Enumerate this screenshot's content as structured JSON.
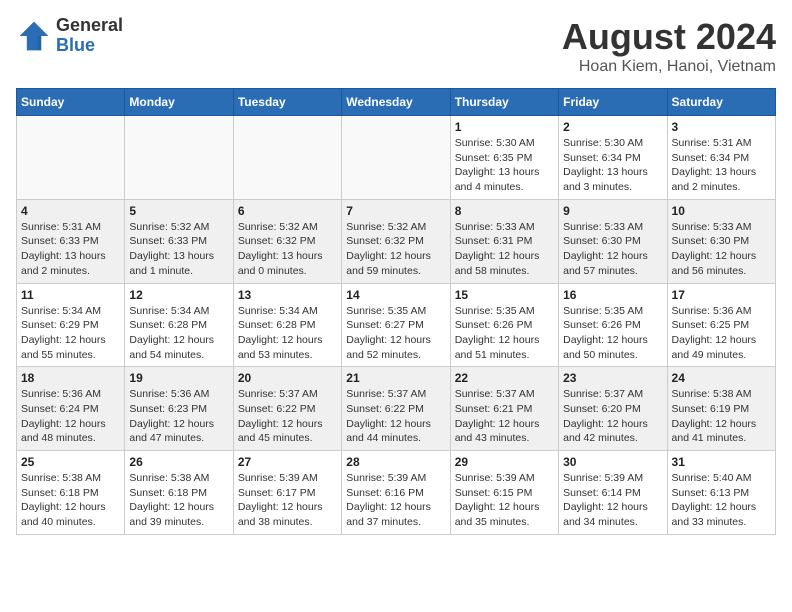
{
  "header": {
    "logo": {
      "general": "General",
      "blue": "Blue"
    },
    "title": "August 2024",
    "location": "Hoan Kiem, Hanoi, Vietnam"
  },
  "weekdays": [
    "Sunday",
    "Monday",
    "Tuesday",
    "Wednesday",
    "Thursday",
    "Friday",
    "Saturday"
  ],
  "weeks": [
    [
      {
        "day": "",
        "info": ""
      },
      {
        "day": "",
        "info": ""
      },
      {
        "day": "",
        "info": ""
      },
      {
        "day": "",
        "info": ""
      },
      {
        "day": "1",
        "info": "Sunrise: 5:30 AM\nSunset: 6:35 PM\nDaylight: 13 hours\nand 4 minutes."
      },
      {
        "day": "2",
        "info": "Sunrise: 5:30 AM\nSunset: 6:34 PM\nDaylight: 13 hours\nand 3 minutes."
      },
      {
        "day": "3",
        "info": "Sunrise: 5:31 AM\nSunset: 6:34 PM\nDaylight: 13 hours\nand 2 minutes."
      }
    ],
    [
      {
        "day": "4",
        "info": "Sunrise: 5:31 AM\nSunset: 6:33 PM\nDaylight: 13 hours\nand 2 minutes."
      },
      {
        "day": "5",
        "info": "Sunrise: 5:32 AM\nSunset: 6:33 PM\nDaylight: 13 hours\nand 1 minute."
      },
      {
        "day": "6",
        "info": "Sunrise: 5:32 AM\nSunset: 6:32 PM\nDaylight: 13 hours\nand 0 minutes."
      },
      {
        "day": "7",
        "info": "Sunrise: 5:32 AM\nSunset: 6:32 PM\nDaylight: 12 hours\nand 59 minutes."
      },
      {
        "day": "8",
        "info": "Sunrise: 5:33 AM\nSunset: 6:31 PM\nDaylight: 12 hours\nand 58 minutes."
      },
      {
        "day": "9",
        "info": "Sunrise: 5:33 AM\nSunset: 6:30 PM\nDaylight: 12 hours\nand 57 minutes."
      },
      {
        "day": "10",
        "info": "Sunrise: 5:33 AM\nSunset: 6:30 PM\nDaylight: 12 hours\nand 56 minutes."
      }
    ],
    [
      {
        "day": "11",
        "info": "Sunrise: 5:34 AM\nSunset: 6:29 PM\nDaylight: 12 hours\nand 55 minutes."
      },
      {
        "day": "12",
        "info": "Sunrise: 5:34 AM\nSunset: 6:28 PM\nDaylight: 12 hours\nand 54 minutes."
      },
      {
        "day": "13",
        "info": "Sunrise: 5:34 AM\nSunset: 6:28 PM\nDaylight: 12 hours\nand 53 minutes."
      },
      {
        "day": "14",
        "info": "Sunrise: 5:35 AM\nSunset: 6:27 PM\nDaylight: 12 hours\nand 52 minutes."
      },
      {
        "day": "15",
        "info": "Sunrise: 5:35 AM\nSunset: 6:26 PM\nDaylight: 12 hours\nand 51 minutes."
      },
      {
        "day": "16",
        "info": "Sunrise: 5:35 AM\nSunset: 6:26 PM\nDaylight: 12 hours\nand 50 minutes."
      },
      {
        "day": "17",
        "info": "Sunrise: 5:36 AM\nSunset: 6:25 PM\nDaylight: 12 hours\nand 49 minutes."
      }
    ],
    [
      {
        "day": "18",
        "info": "Sunrise: 5:36 AM\nSunset: 6:24 PM\nDaylight: 12 hours\nand 48 minutes."
      },
      {
        "day": "19",
        "info": "Sunrise: 5:36 AM\nSunset: 6:23 PM\nDaylight: 12 hours\nand 47 minutes."
      },
      {
        "day": "20",
        "info": "Sunrise: 5:37 AM\nSunset: 6:22 PM\nDaylight: 12 hours\nand 45 minutes."
      },
      {
        "day": "21",
        "info": "Sunrise: 5:37 AM\nSunset: 6:22 PM\nDaylight: 12 hours\nand 44 minutes."
      },
      {
        "day": "22",
        "info": "Sunrise: 5:37 AM\nSunset: 6:21 PM\nDaylight: 12 hours\nand 43 minutes."
      },
      {
        "day": "23",
        "info": "Sunrise: 5:37 AM\nSunset: 6:20 PM\nDaylight: 12 hours\nand 42 minutes."
      },
      {
        "day": "24",
        "info": "Sunrise: 5:38 AM\nSunset: 6:19 PM\nDaylight: 12 hours\nand 41 minutes."
      }
    ],
    [
      {
        "day": "25",
        "info": "Sunrise: 5:38 AM\nSunset: 6:18 PM\nDaylight: 12 hours\nand 40 minutes."
      },
      {
        "day": "26",
        "info": "Sunrise: 5:38 AM\nSunset: 6:18 PM\nDaylight: 12 hours\nand 39 minutes."
      },
      {
        "day": "27",
        "info": "Sunrise: 5:39 AM\nSunset: 6:17 PM\nDaylight: 12 hours\nand 38 minutes."
      },
      {
        "day": "28",
        "info": "Sunrise: 5:39 AM\nSunset: 6:16 PM\nDaylight: 12 hours\nand 37 minutes."
      },
      {
        "day": "29",
        "info": "Sunrise: 5:39 AM\nSunset: 6:15 PM\nDaylight: 12 hours\nand 35 minutes."
      },
      {
        "day": "30",
        "info": "Sunrise: 5:39 AM\nSunset: 6:14 PM\nDaylight: 12 hours\nand 34 minutes."
      },
      {
        "day": "31",
        "info": "Sunrise: 5:40 AM\nSunset: 6:13 PM\nDaylight: 12 hours\nand 33 minutes."
      }
    ]
  ]
}
